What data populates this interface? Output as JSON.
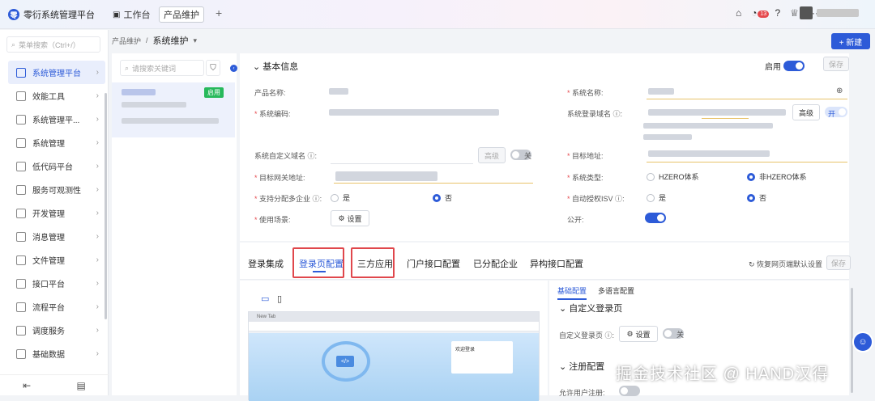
{
  "app": {
    "title": "零衍系统管理平台",
    "logo_icon": "app-logo-icon"
  },
  "tabs": [
    {
      "label": "工作台"
    },
    {
      "label": "产品维护"
    }
  ],
  "header": {
    "notification_count": "13",
    "more": "···"
  },
  "sidebar": {
    "search_placeholder": "菜单搜索（Ctrl+/）",
    "items": [
      {
        "label": "系统管理平台"
      },
      {
        "label": "效能工具"
      },
      {
        "label": "系统管理平..."
      },
      {
        "label": "系统管理"
      },
      {
        "label": "低代码平台"
      },
      {
        "label": "服务可观测性"
      },
      {
        "label": "开发管理"
      },
      {
        "label": "消息管理"
      },
      {
        "label": "文件管理"
      },
      {
        "label": "接口平台"
      },
      {
        "label": "流程平台"
      },
      {
        "label": "调度服务"
      },
      {
        "label": "基础数据"
      }
    ]
  },
  "breadcrumb": {
    "parent": "产品维护",
    "separator": "/",
    "current": "系统维护"
  },
  "actions": {
    "new_label": "+ 新建"
  },
  "list_panel": {
    "search_placeholder": "请搜索关键词",
    "item_tag": "启用"
  },
  "basic_info": {
    "title": "基本信息",
    "enable_label": "启用",
    "save_label": "保存",
    "fields": {
      "product_name": "产品名称:",
      "system_name": "系统名称:",
      "system_code": "系统编码:",
      "login_domain": "系统登录域名",
      "advanced": "高级",
      "on_label": "开",
      "custom_domain": "系统自定义域名",
      "off_label": "关",
      "target_address": "目标地址:",
      "gateway_address": "目标网关地址:",
      "system_type": "系统类型:",
      "hzero": "HZERO体系",
      "non_hzero": "非HZERO体系",
      "multi_tenant": "支持分配多企业",
      "yes": "是",
      "no": "否",
      "auto_isv": "自动授权ISV",
      "usage_scene": "使用场景:",
      "settings": "设置",
      "public": "公开:"
    }
  },
  "config_tabs": {
    "items": [
      {
        "label": "登录集成"
      },
      {
        "label": "登录页配置"
      },
      {
        "label": "三方应用"
      },
      {
        "label": "门户接口配置"
      },
      {
        "label": "已分配企业"
      },
      {
        "label": "异构接口配置"
      }
    ],
    "restore_label": "恢复网页端默认设置",
    "save_label": "保存"
  },
  "preview": {
    "tab_title": "New Tab",
    "login_title": "欢迎登录",
    "code_label": "</>"
  },
  "config_panel": {
    "tabs": [
      {
        "label": "基础配置"
      },
      {
        "label": "多语言配置"
      }
    ],
    "section1": "自定义登录页",
    "custom_login_label": "自定义登录页",
    "settings": "设置",
    "off_label": "关",
    "section2": "注册配置",
    "allow_register_label": "允许用户注册:"
  },
  "watermark": "掘金技术社区 @ HAND汉得",
  "colors": {
    "accent": "#2d5bd8",
    "success": "#27b95b",
    "highlight": "#e0474c",
    "badge": "#e5484d"
  }
}
